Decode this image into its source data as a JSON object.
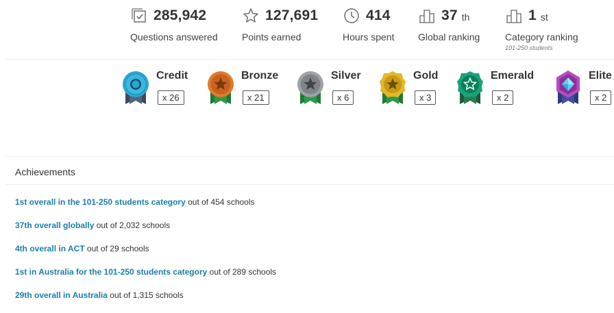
{
  "stats": [
    {
      "value": "285,942",
      "label": "Questions answered",
      "icon": "checkbox-icon"
    },
    {
      "value": "127,691",
      "label": "Points earned",
      "icon": "star-outline-icon"
    },
    {
      "value": "414",
      "label": "Hours spent",
      "icon": "clock-icon"
    },
    {
      "value": "37",
      "suffix": "th",
      "label": "Global ranking",
      "icon": "podium-icon"
    },
    {
      "value": "1",
      "suffix": "st",
      "label": "Category ranking",
      "sublabel": "101-250 students",
      "icon": "podium-icon"
    }
  ],
  "badges": [
    {
      "name": "Credit",
      "count": "x 26",
      "color": "#2aa7d3",
      "icon": "credit-medal-icon"
    },
    {
      "name": "Bronze",
      "count": "x 21",
      "color": "#e07b2e",
      "icon": "bronze-medal-icon"
    },
    {
      "name": "Silver",
      "count": "x 6",
      "color": "#9ea3a8",
      "icon": "silver-medal-icon"
    },
    {
      "name": "Gold",
      "count": "x 3",
      "color": "#e2b72a",
      "icon": "gold-medal-icon"
    },
    {
      "name": "Emerald",
      "count": "x 2",
      "color": "#1aa37a",
      "icon": "emerald-medal-icon"
    },
    {
      "name": "Elite",
      "count": "x 2",
      "color": "#b24fbf",
      "icon": "elite-medal-icon"
    }
  ],
  "achievements": {
    "title": "Achievements",
    "items": [
      {
        "link": "1st overall in the 101-250 students category",
        "rest": " out of 454 schools"
      },
      {
        "link": "37th overall globally",
        "rest": " out of 2,032 schools"
      },
      {
        "link": "4th overall in ACT",
        "rest": " out of 29 schools"
      },
      {
        "link": "1st in Australia for the 101-250 students category",
        "rest": " out of 289 schools"
      },
      {
        "link": "29th overall in Australia",
        "rest": " out of 1,315 schools"
      }
    ]
  },
  "colors": {
    "link": "#1b7fa8",
    "text": "#333333"
  }
}
